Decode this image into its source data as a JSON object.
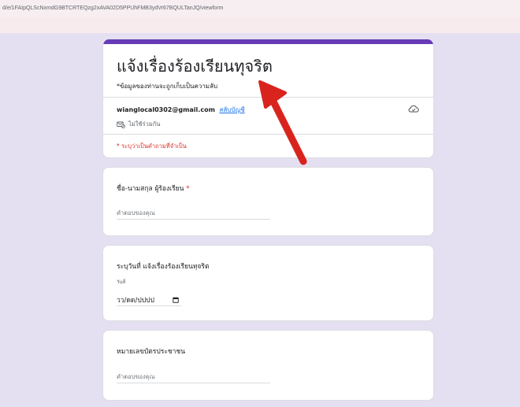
{
  "browser": {
    "url": "d/e/1FAIpQLScNxmdG9BTCRTEQzg2xAVA02D5PPUhFMB3ydVr67BQULTanJQ/viewform"
  },
  "form": {
    "title": "แจ้งเรื่องร้องเรียนทุจริต",
    "description": "*ข้อมูลของท่านจะถูกเก็บเป็นความลับ",
    "account_email": "wianglocal0302@gmail.com",
    "switch_account_label": "สลับบัญชี",
    "not_shared_label": "ไม่ใช้ร่วมกัน",
    "required_note": "* ระบุว่าเป็นคำถามที่จำเป็น",
    "accent_color": "#673ab7",
    "required_color": "#d93025",
    "link_color": "#1a73e8",
    "icons": [
      "cloud-icon",
      "not-shared-icon",
      "calendar-icon"
    ]
  },
  "questions": [
    {
      "title": "ชื่อ-นามสกุล ผู้ร้องเรียน",
      "required_mark": "*",
      "placeholder": "คำตอบของคุณ"
    },
    {
      "title": "ระบุวันที่ แจ้งเรื่องร้องเรียนทุจริต",
      "date_label": "วันที่",
      "date_placeholder": "วว/ดด/ปปปป"
    },
    {
      "title": "หมายเลขบัตรประชาชน",
      "placeholder": "คำตอบของคุณ"
    }
  ]
}
